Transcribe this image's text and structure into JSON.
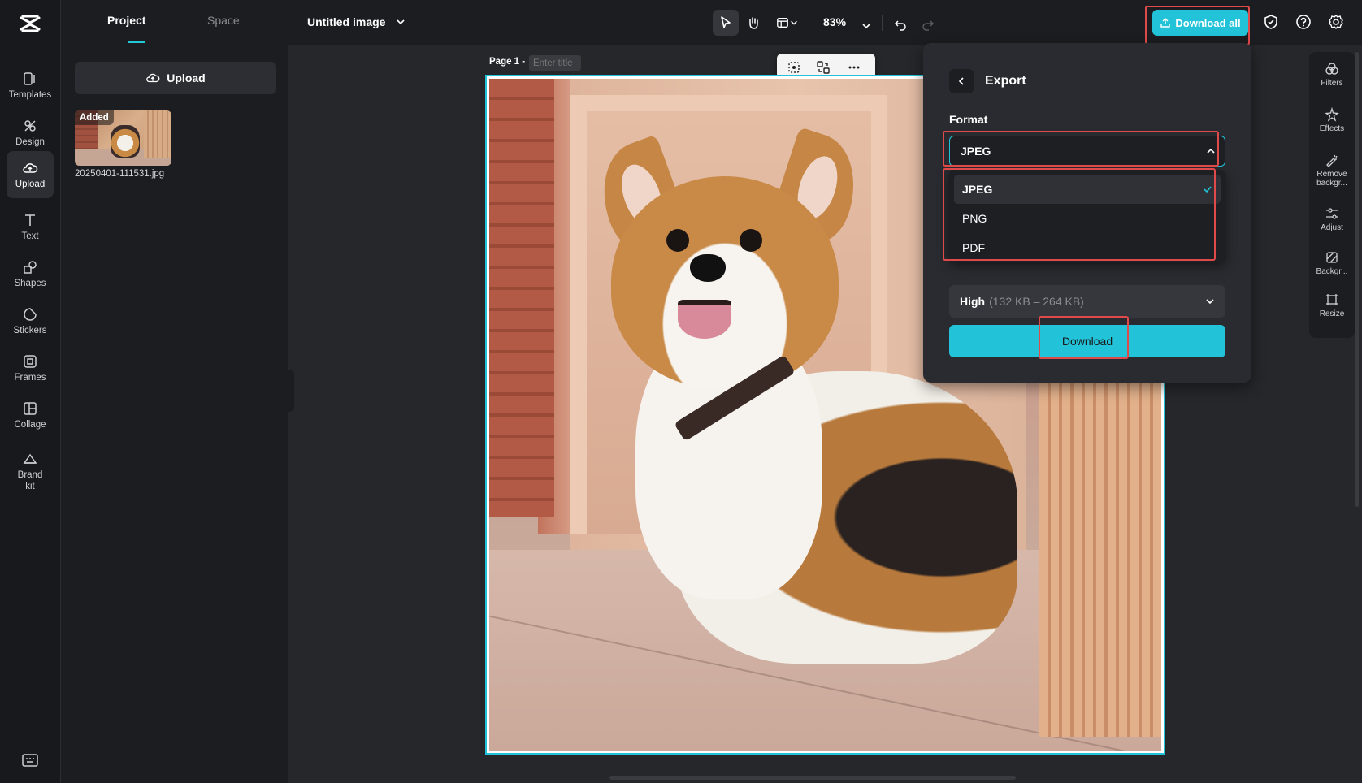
{
  "rail": {
    "items": [
      {
        "label": "Templates",
        "icon": "templates-icon"
      },
      {
        "label": "Design",
        "icon": "design-icon"
      },
      {
        "label": "Upload",
        "icon": "upload-cloud-icon"
      },
      {
        "label": "Text",
        "icon": "text-icon"
      },
      {
        "label": "Shapes",
        "icon": "shapes-icon"
      },
      {
        "label": "Stickers",
        "icon": "stickers-icon"
      },
      {
        "label": "Frames",
        "icon": "frames-icon"
      },
      {
        "label": "Collage",
        "icon": "collage-icon"
      },
      {
        "label": "Brand kit",
        "icon": "brand-kit-icon"
      }
    ],
    "active": "Upload"
  },
  "panel": {
    "tabs": [
      {
        "label": "Project"
      },
      {
        "label": "Space"
      }
    ],
    "upload_label": "Upload",
    "asset": {
      "badge": "Added",
      "filename": "20250401-111531.jpg"
    }
  },
  "topbar": {
    "title": "Untitled image",
    "zoom": "83%",
    "download_all": "Download all"
  },
  "canvas": {
    "page_label": "Page 1 -",
    "title_placeholder": "Enter title"
  },
  "export": {
    "title": "Export",
    "format_label": "Format",
    "selected_format": "JPEG",
    "options": [
      "JPEG",
      "PNG",
      "PDF"
    ],
    "quality_label": "High",
    "quality_size": "(132 KB – 264 KB)",
    "download_label": "Download"
  },
  "right_tools": [
    {
      "label": "Filters",
      "icon": "filters-icon"
    },
    {
      "label": "Effects",
      "icon": "effects-icon"
    },
    {
      "label": "Remove backgr...",
      "icon": "remove-background-icon"
    },
    {
      "label": "Adjust",
      "icon": "adjust-icon"
    },
    {
      "label": "Backgr...",
      "icon": "background-icon"
    },
    {
      "label": "Resize",
      "icon": "resize-icon"
    }
  ],
  "colors": {
    "accent": "#22c3d9",
    "highlight": "#e04a4a",
    "bg": "#26272b"
  }
}
